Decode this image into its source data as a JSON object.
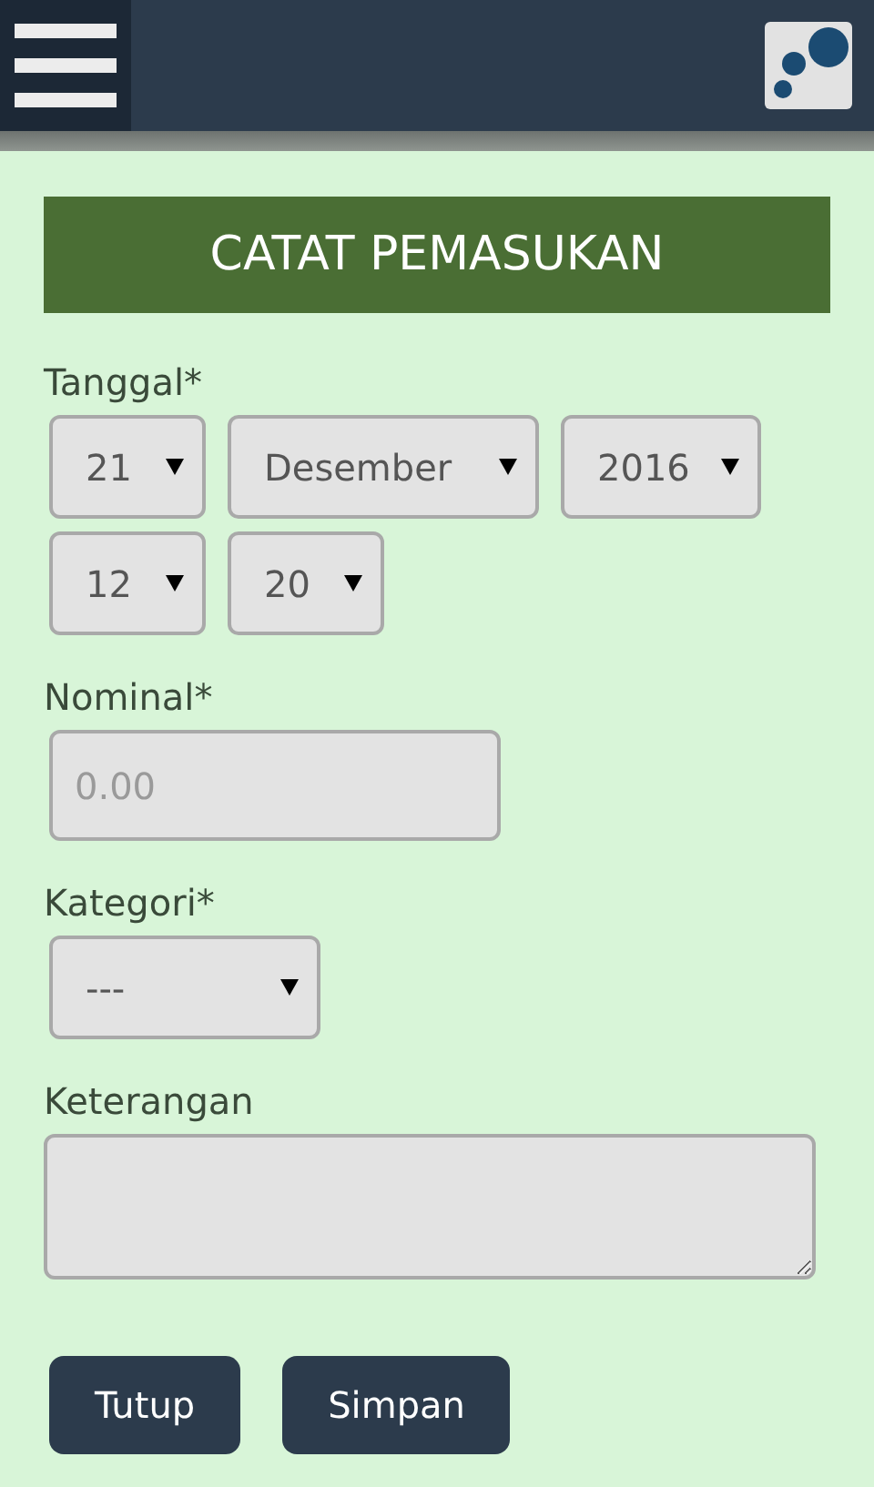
{
  "form": {
    "title": "CATAT PEMASUKAN",
    "fields": [
      {
        "kind": "selects",
        "label": "Tanggal*",
        "rows": [
          [
            {
              "value": "21"
            },
            {
              "value": "Desember"
            },
            {
              "value": "2016"
            }
          ],
          [
            {
              "value": "12"
            },
            {
              "value": "20"
            }
          ]
        ]
      },
      {
        "kind": "input",
        "label": "Nominal*",
        "placeholder": "0.00"
      },
      {
        "kind": "select",
        "label": "Kategori*",
        "value": "---"
      },
      {
        "kind": "textarea",
        "label": "Keterangan"
      }
    ],
    "buttons": [
      "Tutup",
      "Simpan"
    ]
  }
}
